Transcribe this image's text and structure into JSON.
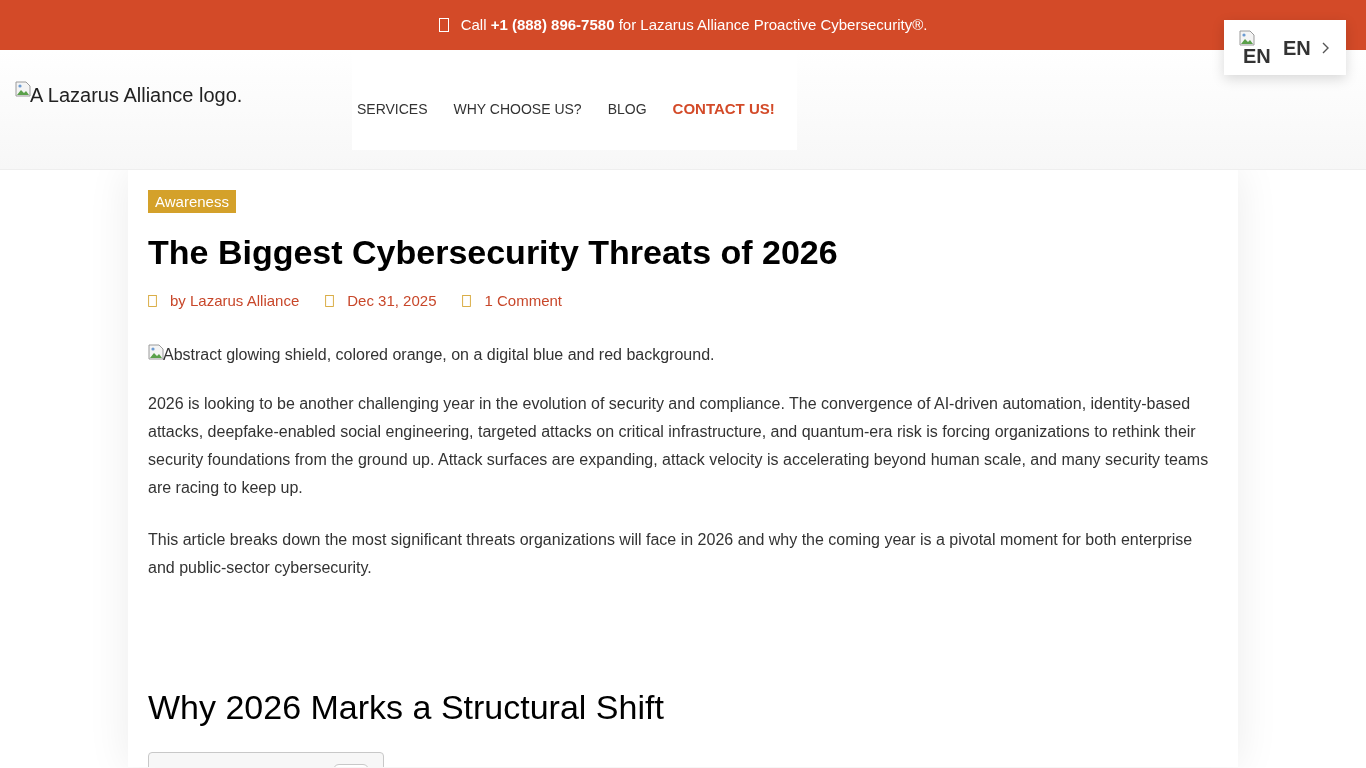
{
  "top_bar": {
    "text": "Call **+1 (888) 896-7580** for Lazarus Alliance Proactive Cybersecurity®."
  },
  "header": {
    "logo_alt": "A Lazarus Alliance logo.",
    "nav": [
      {
        "label": "SERVICES",
        "kind": "link"
      },
      {
        "label": "WHY CHOOSE US?",
        "kind": "link"
      },
      {
        "label": "BLOG",
        "kind": "link"
      },
      {
        "label": "CONTACT US!",
        "kind": "cta"
      }
    ]
  },
  "language_switcher": {
    "flag_alt": "EN",
    "label": "EN"
  },
  "article": {
    "category": "Awareness",
    "title": "The Biggest Cybersecurity Threats of 2026",
    "meta": [
      "by Lazarus Alliance",
      "Dec 31, 2025",
      "1 Comment"
    ],
    "image_alt": "Abstract glowing shield, colored orange, on a digital blue and red background.",
    "paragraphs": [
      "2026 is looking to be another challenging year in the evolution of security and compliance. The convergence of AI-driven automation, identity-based attacks, deepfake-enabled social engineering, targeted attacks on critical infrastructure, and quantum-era risk is forcing organizations to rethink their security foundations from the ground up. Attack surfaces are expanding, attack velocity is accelerating beyond human scale, and many security teams are racing to keep up.",
      "This article breaks down the most significant threats organizations will face in 2026 and why the coming year is a pivotal moment for both enterprise and public-sector cybersecurity."
    ],
    "heading": "Why 2026 Marks a Structural Shift"
  }
}
